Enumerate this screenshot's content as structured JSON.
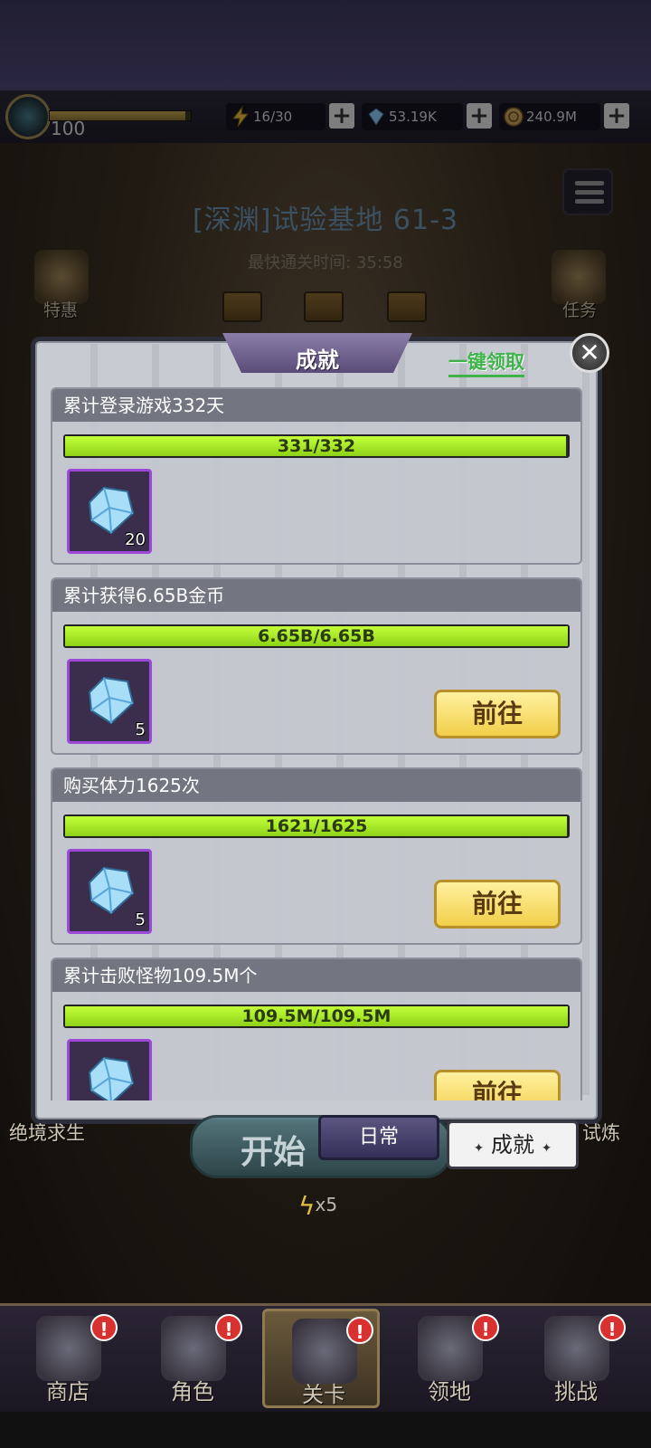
{
  "top_bar": {
    "level": "100",
    "stamina": "16/30",
    "gems": "53.19K",
    "gold": "240.9M",
    "plus": "+"
  },
  "stage": {
    "title": "[深渊]试验基地 61-3",
    "fastest_clear": "最快通关时间:   35:58"
  },
  "side_buttons": {
    "left": "特惠",
    "right": "任务"
  },
  "panel": {
    "title": "成就",
    "claim_all": "一键领取",
    "close": "✕"
  },
  "achievements": [
    {
      "title": "累计登录游戏332天",
      "progress_text": "331/332",
      "progress": 0.997,
      "reward_qty": "20",
      "action": ""
    },
    {
      "title": "累计获得6.65B金币",
      "progress_text": "6.65B/6.65B",
      "progress": 1.0,
      "reward_qty": "5",
      "action": "前往"
    },
    {
      "title": "购买体力1625次",
      "progress_text": "1621/1625",
      "progress": 0.9975,
      "reward_qty": "5",
      "action": "前往"
    },
    {
      "title": "累计击败怪物109.5M个",
      "progress_text": "109.5M/109.5M",
      "progress": 1.0,
      "reward_qty": "",
      "action": "前往"
    }
  ],
  "tabs": {
    "daily": "日常",
    "achievement": "成就",
    "diamond_left": "✦",
    "diamond_right": "✦"
  },
  "side_mode_labels": {
    "left": "绝境求生",
    "right": "试炼"
  },
  "start": {
    "label": "开始",
    "cost": "x5"
  },
  "bottom_nav": [
    {
      "label": "商店",
      "badge": "!"
    },
    {
      "label": "角色",
      "badge": "!"
    },
    {
      "label": "关卡",
      "badge": "!"
    },
    {
      "label": "领地",
      "badge": "!"
    },
    {
      "label": "挑战",
      "badge": "!"
    }
  ],
  "colors": {
    "progress_fill": "#a8ec2a",
    "reward_border": "#9c48d8",
    "go_button": "#f2cf4a",
    "claim_all": "#3fb34a"
  },
  "icons": {
    "stamina": "lightning-icon",
    "gems": "gem-icon",
    "gold": "coin-icon",
    "reward": "diamond-gem-icon",
    "menu": "list-icon",
    "close": "close-icon"
  }
}
